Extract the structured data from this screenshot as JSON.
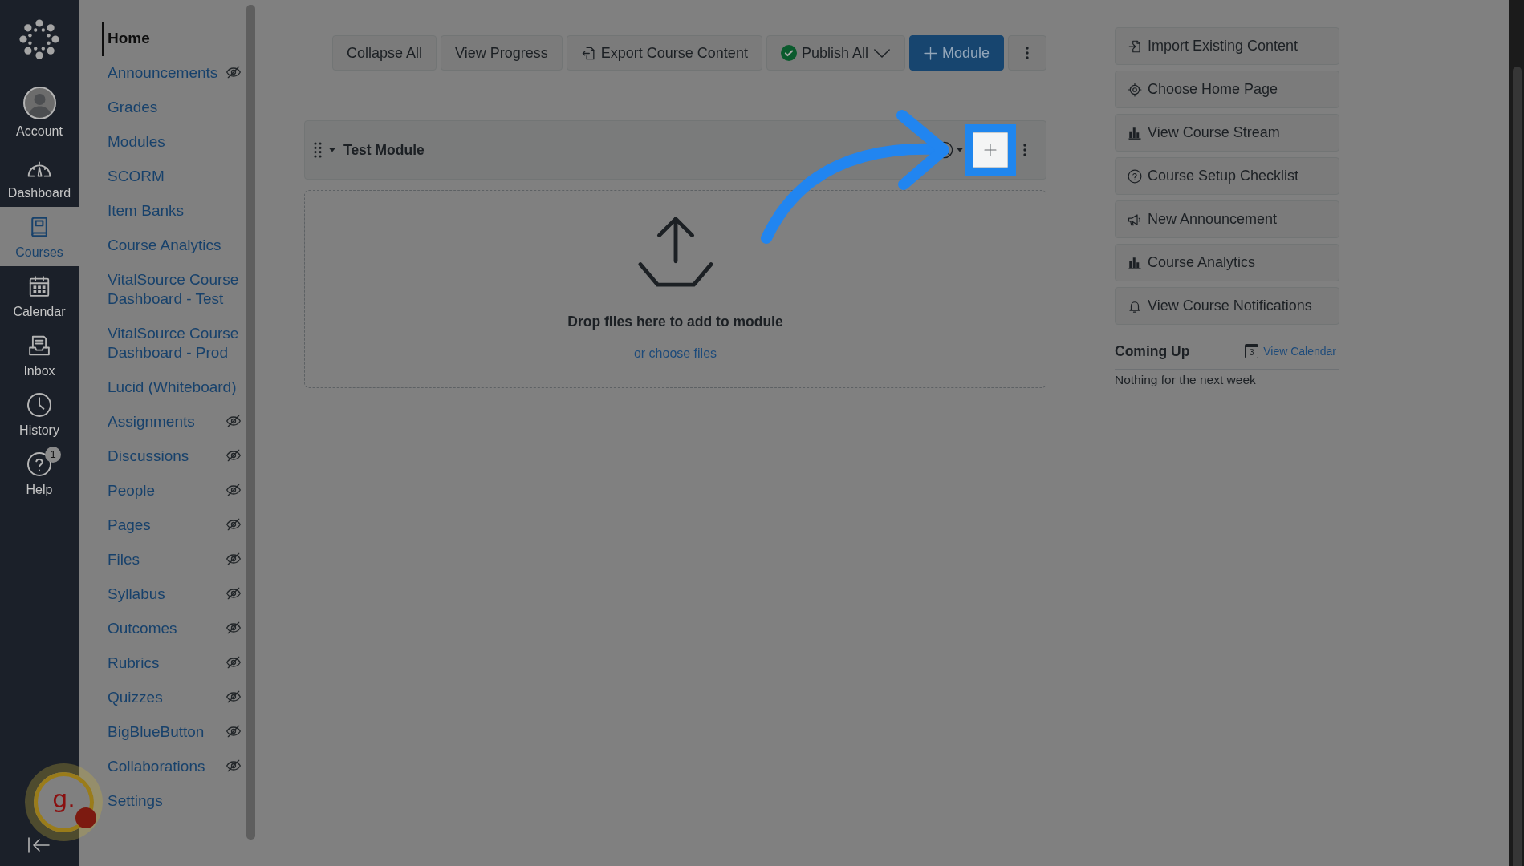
{
  "tour": {
    "dimmed": true,
    "arrow": true
  },
  "global_nav": {
    "items": [
      {
        "kind": "account",
        "label": "Account",
        "selected": false
      },
      {
        "kind": "dashboard",
        "label": "Dashboard",
        "selected": false
      },
      {
        "kind": "courses",
        "label": "Courses",
        "selected": true
      },
      {
        "kind": "calendar",
        "label": "Calendar",
        "selected": false
      },
      {
        "kind": "inbox",
        "label": "Inbox",
        "selected": false
      },
      {
        "kind": "history",
        "label": "History",
        "selected": false
      },
      {
        "kind": "help",
        "label": "Help",
        "selected": false,
        "badge": "1"
      }
    ]
  },
  "course_nav": {
    "items": [
      {
        "label": "Home",
        "selected": true,
        "hidden": false
      },
      {
        "label": "Announcements",
        "selected": false,
        "hidden": true
      },
      {
        "label": "Grades",
        "selected": false,
        "hidden": false
      },
      {
        "label": "Modules",
        "selected": false,
        "hidden": false
      },
      {
        "label": "SCORM",
        "selected": false,
        "hidden": false
      },
      {
        "label": "Item Banks",
        "selected": false,
        "hidden": false
      },
      {
        "label": "Course Analytics",
        "selected": false,
        "hidden": false
      },
      {
        "label": "VitalSource Course Dashboard - Test",
        "selected": false,
        "hidden": false
      },
      {
        "label": "VitalSource Course Dashboard - Prod",
        "selected": false,
        "hidden": false
      },
      {
        "label": "Lucid (Whiteboard)",
        "selected": false,
        "hidden": false
      },
      {
        "label": "Assignments",
        "selected": false,
        "hidden": true
      },
      {
        "label": "Discussions",
        "selected": false,
        "hidden": true
      },
      {
        "label": "People",
        "selected": false,
        "hidden": true
      },
      {
        "label": "Pages",
        "selected": false,
        "hidden": true
      },
      {
        "label": "Files",
        "selected": false,
        "hidden": true
      },
      {
        "label": "Syllabus",
        "selected": false,
        "hidden": true
      },
      {
        "label": "Outcomes",
        "selected": false,
        "hidden": true
      },
      {
        "label": "Rubrics",
        "selected": false,
        "hidden": true
      },
      {
        "label": "Quizzes",
        "selected": false,
        "hidden": true
      },
      {
        "label": "BigBlueButton",
        "selected": false,
        "hidden": true
      },
      {
        "label": "Collaborations",
        "selected": false,
        "hidden": true
      },
      {
        "label": "Settings",
        "selected": false,
        "hidden": false
      }
    ]
  },
  "toolbar": {
    "buttons": [
      {
        "kind": "plain",
        "label": "Collapse All"
      },
      {
        "kind": "plain",
        "label": "View Progress"
      },
      {
        "kind": "export",
        "label": "Export Course Content"
      },
      {
        "kind": "publish",
        "label": "Publish All"
      },
      {
        "kind": "primary",
        "label": "Module"
      },
      {
        "kind": "more"
      }
    ]
  },
  "module": {
    "title": "Test Module",
    "expanded": true,
    "published": false,
    "add_highlighted": true
  },
  "dropzone": {
    "title": "Drop files here to add to module",
    "link": "or choose files"
  },
  "sidebar": {
    "buttons": [
      {
        "kind": "import",
        "label": "Import Existing Content"
      },
      {
        "kind": "home",
        "label": "Choose Home Page"
      },
      {
        "kind": "stream",
        "label": "View Course Stream"
      },
      {
        "kind": "checklist",
        "label": "Course Setup Checklist"
      },
      {
        "kind": "announcement",
        "label": "New Announcement"
      },
      {
        "kind": "analytics",
        "label": "Course Analytics"
      },
      {
        "kind": "notifications",
        "label": "View Course Notifications"
      }
    ]
  },
  "coming_up": {
    "title": "Coming Up",
    "calendar_day": "3",
    "link": "View Calendar",
    "empty": "Nothing for the next week"
  },
  "widget": {
    "label": "g.",
    "alert": true
  }
}
